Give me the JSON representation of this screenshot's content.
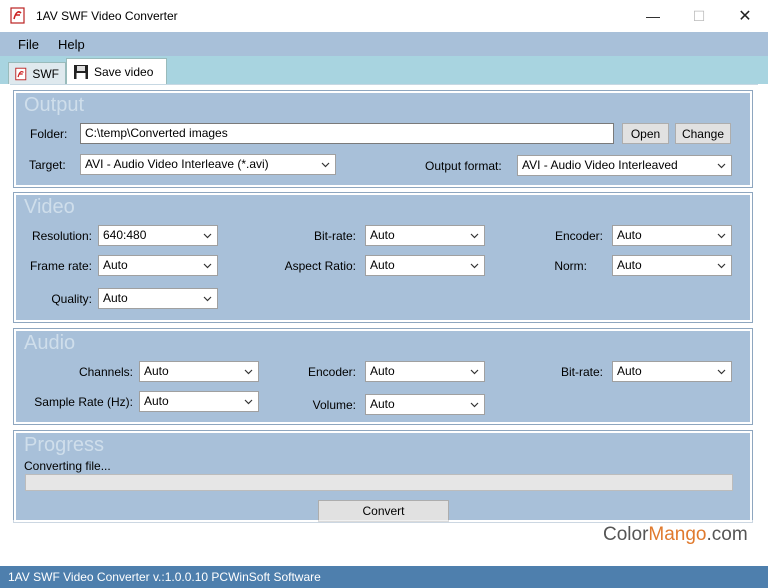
{
  "window": {
    "title": "1AV SWF Video Converter",
    "controls": {
      "minimize": "—",
      "maximize": "☐",
      "close": "✕"
    }
  },
  "menu": {
    "items": [
      "File",
      "Help"
    ]
  },
  "tabs": [
    {
      "label": "SWF",
      "icon": "swf-file-icon"
    },
    {
      "label": "Save video",
      "icon": "floppy-disk-icon"
    }
  ],
  "output": {
    "title": "Output",
    "folder_label": "Folder:",
    "folder_value": "C:\\temp\\Converted images",
    "open_button": "Open",
    "change_button": "Change",
    "target_label": "Target:",
    "target_value": "AVI - Audio Video Interleave (*.avi)",
    "format_label": "Output format:",
    "format_value": "AVI - Audio Video Interleaved"
  },
  "video": {
    "title": "Video",
    "resolution_label": "Resolution:",
    "resolution_value": "640:480",
    "bitrate_label": "Bit-rate:",
    "bitrate_value": "Auto",
    "encoder_label": "Encoder:",
    "encoder_value": "Auto",
    "framerate_label": "Frame rate:",
    "framerate_value": "Auto",
    "aspect_label": "Aspect Ratio:",
    "aspect_value": "Auto",
    "norm_label": "Norm:",
    "norm_value": "Auto",
    "quality_label": "Quality:",
    "quality_value": "Auto"
  },
  "audio": {
    "title": "Audio",
    "channels_label": "Channels:",
    "channels_value": "Auto",
    "encoder_label": "Encoder:",
    "encoder_value": "Auto",
    "bitrate_label": "Bit-rate:",
    "bitrate_value": "Auto",
    "samplerate_label": "Sample Rate (Hz):",
    "samplerate_value": "Auto",
    "volume_label": "Volume:",
    "volume_value": "Auto"
  },
  "progress": {
    "title": "Progress",
    "status": "Converting file...",
    "convert_button": "Convert",
    "fraction": 0
  },
  "statusbar": {
    "text": "1AV SWF Video Converter v.:1.0.0.10 PCWinSoft Software"
  },
  "watermark": {
    "part1": "Color",
    "part2": "Mango",
    "part3": ".com"
  },
  "colors": {
    "panel_bg": "#a8c0d9",
    "menubar_bg": "#a8c0d9",
    "statusbar_bg": "#4e7fad",
    "tabstrip_bg": "#a8d4e0"
  }
}
